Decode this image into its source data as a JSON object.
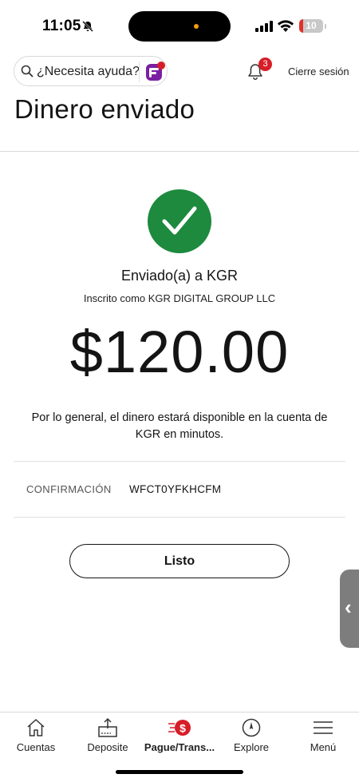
{
  "status_bar": {
    "time": "11:05",
    "battery": "10"
  },
  "header": {
    "search_placeholder": "¿Necesita ayuda?",
    "notification_count": "3",
    "signout_label": "Cierre sesión"
  },
  "page": {
    "title": "Dinero enviado"
  },
  "confirmation": {
    "sent_to": "Enviado(a) a KGR",
    "enrolled_as": "Inscrito como KGR DIGITAL GROUP LLC",
    "amount": "$120.00",
    "availability_note": "Por lo general, el dinero estará disponible en la cuenta de KGR en minutos.",
    "code_label": "CONFIRMACIÓN",
    "code_value": "WFCT0YFKHCFM",
    "done_label": "Listo"
  },
  "bottom_nav": {
    "items": [
      {
        "label": "Cuentas",
        "icon": "home-icon"
      },
      {
        "label": "Deposite",
        "icon": "deposit-icon"
      },
      {
        "label": "Pague/Trans...",
        "icon": "pay-transfer-icon"
      },
      {
        "label": "Explore",
        "icon": "compass-icon"
      },
      {
        "label": "Menú",
        "icon": "menu-icon"
      }
    ]
  },
  "colors": {
    "brand_red": "#d71e28",
    "success_green": "#1d8a3e",
    "text": "#141414"
  }
}
